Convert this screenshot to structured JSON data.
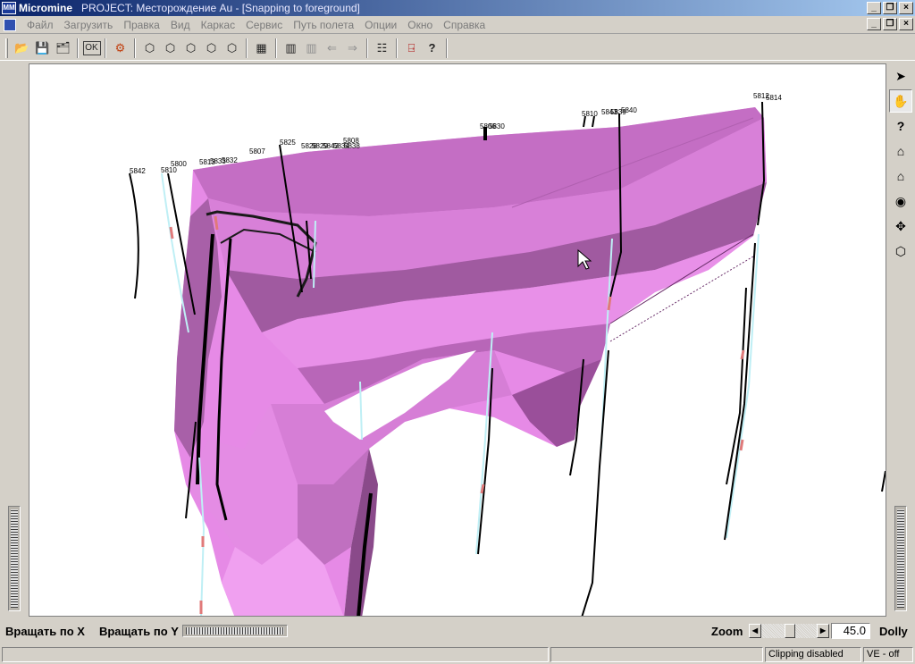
{
  "window": {
    "app_name": "Micromine",
    "title": "PROJECT: Месторождение Au - [Snapping to foreground]",
    "app_icon_text": "MM"
  },
  "menu": {
    "items": [
      "Файл",
      "Загрузить",
      "Правка",
      "Вид",
      "Каркас",
      "Сервис",
      "Путь полета",
      "Опции",
      "Окно",
      "Справка"
    ]
  },
  "toolbar": {
    "buttons": [
      {
        "name": "open-folder-icon",
        "glyph": "📂"
      },
      {
        "name": "save-icon",
        "glyph": "💾"
      },
      {
        "name": "save-all-icon",
        "glyph": "🗂"
      },
      {
        "name": "ok-button",
        "glyph": "OK"
      },
      {
        "name": "layers-icon",
        "glyph": "⚙"
      },
      {
        "name": "view-front-icon",
        "glyph": "⬡"
      },
      {
        "name": "view-side-icon",
        "glyph": "⬡"
      },
      {
        "name": "view-top-icon",
        "glyph": "⬡"
      },
      {
        "name": "view-iso-icon",
        "glyph": "⬡"
      },
      {
        "name": "view-back-icon",
        "glyph": "⬡"
      },
      {
        "name": "grid-icon",
        "glyph": "▦"
      },
      {
        "name": "section-icon",
        "glyph": "▥"
      },
      {
        "name": "section-disabled-icon",
        "glyph": "▥"
      },
      {
        "name": "arrow-left-icon",
        "glyph": "⇐"
      },
      {
        "name": "arrow-right-icon",
        "glyph": "⇒"
      },
      {
        "name": "properties-icon",
        "glyph": "☷"
      },
      {
        "name": "exit-icon",
        "glyph": "⍈"
      },
      {
        "name": "help-pointer-icon",
        "glyph": "?"
      }
    ]
  },
  "right_tools": [
    {
      "name": "pointer-icon",
      "glyph": "➤"
    },
    {
      "name": "hand-pan-icon",
      "glyph": "✋"
    },
    {
      "name": "query-icon",
      "glyph": "?"
    },
    {
      "name": "home-icon",
      "glyph": "⌂"
    },
    {
      "name": "home-zoom-icon",
      "glyph": "⌂"
    },
    {
      "name": "eye-icon",
      "glyph": "◉"
    },
    {
      "name": "center-target-icon",
      "glyph": "✥"
    },
    {
      "name": "cube-icon",
      "glyph": "⬡"
    }
  ],
  "viewport": {
    "hole_labels": [
      "5842",
      "5810",
      "5800",
      "5813",
      "5833",
      "5832",
      "5807",
      "5825",
      "5828",
      "5829",
      "5843",
      "5834",
      "5838",
      "5808",
      "5806",
      "5830",
      "5810",
      "5843",
      "5839",
      "5840",
      "5812",
      "5814"
    ]
  },
  "bottom": {
    "rotate_x_label": "Вращать по  X",
    "rotate_y_label": "Вращать по Y",
    "zoom_label": "Zoom",
    "zoom_value": "45.0",
    "dolly_label": "Dolly",
    "zoom_thumb_pct": 52
  },
  "status": {
    "clipping": "Clipping disabled",
    "ve": "VE - off"
  },
  "colors": {
    "solid_light": "#e68ae6",
    "solid_mid": "#c46ec4",
    "solid_dark": "#8a4a8a",
    "trace": "#000000",
    "sample": "#bfeff5"
  }
}
